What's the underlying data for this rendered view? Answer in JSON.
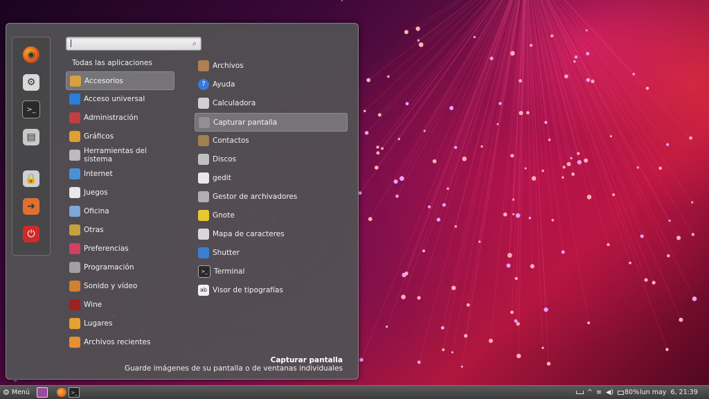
{
  "search": {
    "placeholder": "",
    "icon": "search-icon"
  },
  "favorites": [
    {
      "name": "firefox",
      "icon": "firefox-icon",
      "color": "#e8681c"
    },
    {
      "name": "configuracion",
      "icon": "settings-icon",
      "color": "#d9d9d9"
    },
    {
      "name": "terminal",
      "icon": "terminal-icon",
      "color": "#2a2a2a"
    },
    {
      "name": "archivos",
      "icon": "file-cabinet-icon",
      "color": "#c9c9c9"
    },
    {
      "name": "bloquear",
      "icon": "lock-screen-icon",
      "color": "#d0d0d0"
    },
    {
      "name": "cerrar-sesion",
      "icon": "logout-icon",
      "color": "#e07030"
    },
    {
      "name": "apagar",
      "icon": "power-icon",
      "color": "#d02a2a"
    }
  ],
  "categories_title": "Todas las aplicaciones",
  "categories": [
    {
      "label": "Accesorios",
      "icon": "accessories-icon",
      "color": "#d8a040",
      "selected": true
    },
    {
      "label": "Acceso universal",
      "icon": "accessibility-icon",
      "color": "#2a7fd8"
    },
    {
      "label": "Administración",
      "icon": "admin-icon",
      "color": "#c04040"
    },
    {
      "label": "Gráficos",
      "icon": "graphics-icon",
      "color": "#e0a030"
    },
    {
      "label": "Herramientas del sistema",
      "icon": "system-tools-icon",
      "color": "#bbbbbb"
    },
    {
      "label": "Internet",
      "icon": "internet-icon",
      "color": "#4a90d8"
    },
    {
      "label": "Juegos",
      "icon": "games-icon",
      "color": "#e8e8e8"
    },
    {
      "label": "Oficina",
      "icon": "office-icon",
      "color": "#7aa8d8"
    },
    {
      "label": "Otras",
      "icon": "other-icon",
      "color": "#c8a040"
    },
    {
      "label": "Preferencias",
      "icon": "preferences-icon",
      "color": "#d04060"
    },
    {
      "label": "Programación",
      "icon": "programming-icon",
      "color": "#a0a0a0"
    },
    {
      "label": "Sonido y vídeo",
      "icon": "sound-video-icon",
      "color": "#d08030"
    },
    {
      "label": "Wine",
      "icon": "wine-icon",
      "color": "#a02020"
    },
    {
      "label": "Lugares",
      "icon": "places-icon",
      "color": "#e8a030"
    },
    {
      "label": "Archivos recientes",
      "icon": "recent-files-icon",
      "color": "#e89030"
    }
  ],
  "apps": [
    {
      "label": "Archivos",
      "icon": "files-icon",
      "color": "#b08050"
    },
    {
      "label": "Ayuda",
      "icon": "help-icon",
      "color": "#3a7ad8"
    },
    {
      "label": "Calculadora",
      "icon": "calculator-icon",
      "color": "#d0d0d0"
    },
    {
      "label": "Capturar pantalla",
      "icon": "screenshot-icon",
      "color": "#909090",
      "selected": true
    },
    {
      "label": "Contactos",
      "icon": "contacts-icon",
      "color": "#a08050"
    },
    {
      "label": "Discos",
      "icon": "disks-icon",
      "color": "#c0c0c0"
    },
    {
      "label": "gedit",
      "icon": "gedit-icon",
      "color": "#e8e8e8"
    },
    {
      "label": "Gestor de archivadores",
      "icon": "archive-manager-icon",
      "color": "#b0b0b0"
    },
    {
      "label": "Gnote",
      "icon": "gnote-icon",
      "color": "#e8c830"
    },
    {
      "label": "Mapa de caracteres",
      "icon": "character-map-icon",
      "color": "#d8d8d8"
    },
    {
      "label": "Shutter",
      "icon": "shutter-icon",
      "color": "#3a80d0"
    },
    {
      "label": "Terminal",
      "icon": "terminal-icon",
      "color": "#2a2a2a"
    },
    {
      "label": "Visor de tipografías",
      "icon": "font-viewer-icon",
      "color": "#f0f0f0"
    }
  ],
  "description": {
    "title": "Capturar pantalla",
    "text": "Guarde imágenes de su pantalla o de ventanas individuales"
  },
  "panel": {
    "menu_label": "Menú",
    "battery": "80%",
    "clock": "lun may  6, 21:39"
  }
}
